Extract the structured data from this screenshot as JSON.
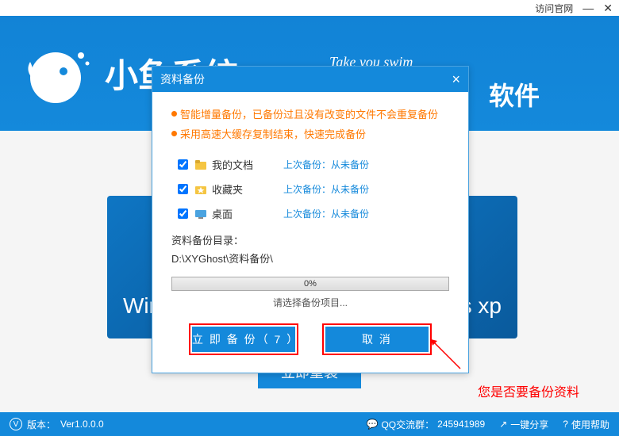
{
  "titlebar": {
    "visit_official": "访问官网"
  },
  "header": {
    "logo_text": "小鱼系统",
    "tagline": "Take you swim",
    "software": "软件"
  },
  "main": {
    "os_left": "Wir",
    "os_right": "ws xp",
    "reinstall_btn": "立即重装"
  },
  "dialog": {
    "title": "资料备份",
    "bullets": [
      "智能增量备份，已备份过且没有改变的文件不会重复备份",
      "采用高速大缓存复制结束，快速完成备份"
    ],
    "items": [
      {
        "label": "我的文档",
        "last": "上次备份：从未备份"
      },
      {
        "label": "收藏夹",
        "last": "上次备份：从未备份"
      },
      {
        "label": "桌面",
        "last": "上次备份：从未备份"
      }
    ],
    "dir_label": "资料备份目录：",
    "dir_path": "D:\\XYGhost\\资料备份\\",
    "progress_pct": "0%",
    "progress_msg": "请选择备份项目...",
    "backup_btn": "立 即 备 份（ 7 ）",
    "cancel_btn": "取  消"
  },
  "annotation": "您是否要备份资料",
  "footer": {
    "version_label": "版本：",
    "version": "Ver1.0.0.0",
    "qq_label": "QQ交流群：",
    "qq": "245941989",
    "share": "一键分享",
    "help": "使用帮助"
  }
}
